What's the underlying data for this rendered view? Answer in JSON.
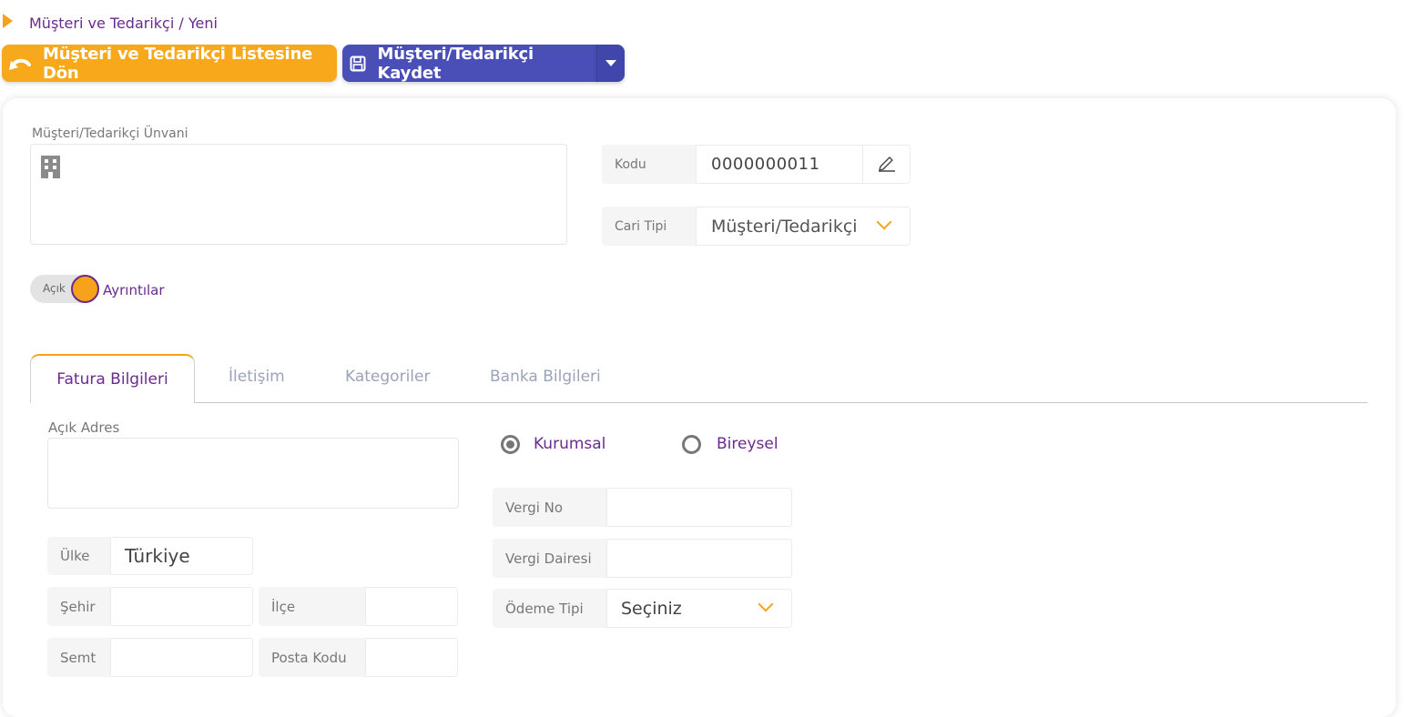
{
  "breadcrumb": "Müşteri ve Tedarikçi / Yeni",
  "toolbar": {
    "back_label": "Müşteri ve Tedarikçi Listesine Dön",
    "save_label": "Müşteri/Tedarikçi Kaydet"
  },
  "form": {
    "title_label": "Müşteri/Tedarikçi Ünvani",
    "title_value": "",
    "code_label": "Kodu",
    "code_value": "0000000011",
    "type_label": "Cari Tipi",
    "type_value": "Müşteri/Tedarikçi",
    "toggle_state": "Açık",
    "toggle_label": "Ayrıntılar"
  },
  "tabs": [
    {
      "label": "Fatura Bilgileri",
      "active": true
    },
    {
      "label": "İletişim",
      "active": false
    },
    {
      "label": "Kategoriler",
      "active": false
    },
    {
      "label": "Banka Bilgileri",
      "active": false
    }
  ],
  "invoice": {
    "address_label": "Açık Adres",
    "address_value": "",
    "country_label": "Ülke",
    "country_value": "Türkiye",
    "city_label": "Şehir",
    "city_value": "",
    "district_label": "İlçe",
    "district_value": "",
    "neighborhood_label": "Semt",
    "neighborhood_value": "",
    "postal_label": "Posta Kodu",
    "postal_value": "",
    "radio_corporate": "Kurumsal",
    "radio_individual": "Bireysel",
    "selected_type": "Kurumsal",
    "tax_no_label": "Vergi No",
    "tax_no_value": "",
    "tax_office_label": "Vergi Dairesi",
    "tax_office_value": "",
    "payment_label": "Ödeme Tipi",
    "payment_value": "Seçiniz"
  },
  "colors": {
    "accent_orange": "#f7a81b",
    "accent_blue": "#4a4fb8",
    "accent_purple": "#6a2a8e"
  },
  "icons": {
    "back": "undo-arrow-icon",
    "save": "floppy-disk-icon",
    "dropdown": "caret-down-icon",
    "building": "building-icon",
    "edit": "pencil-icon",
    "chevron": "chevron-down-icon"
  }
}
